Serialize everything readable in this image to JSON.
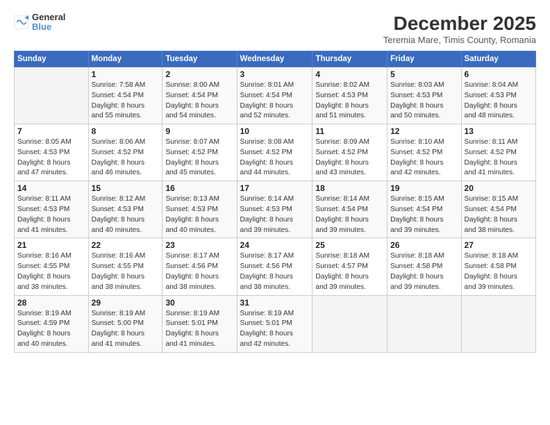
{
  "logo": {
    "line1": "General",
    "line2": "Blue"
  },
  "title": "December 2025",
  "location": "Teremia Mare, Timis County, Romania",
  "days_of_week": [
    "Sunday",
    "Monday",
    "Tuesday",
    "Wednesday",
    "Thursday",
    "Friday",
    "Saturday"
  ],
  "weeks": [
    [
      {
        "day": "",
        "info": ""
      },
      {
        "day": "1",
        "info": "Sunrise: 7:58 AM\nSunset: 4:54 PM\nDaylight: 8 hours\nand 55 minutes."
      },
      {
        "day": "2",
        "info": "Sunrise: 8:00 AM\nSunset: 4:54 PM\nDaylight: 8 hours\nand 54 minutes."
      },
      {
        "day": "3",
        "info": "Sunrise: 8:01 AM\nSunset: 4:54 PM\nDaylight: 8 hours\nand 52 minutes."
      },
      {
        "day": "4",
        "info": "Sunrise: 8:02 AM\nSunset: 4:53 PM\nDaylight: 8 hours\nand 51 minutes."
      },
      {
        "day": "5",
        "info": "Sunrise: 8:03 AM\nSunset: 4:53 PM\nDaylight: 8 hours\nand 50 minutes."
      },
      {
        "day": "6",
        "info": "Sunrise: 8:04 AM\nSunset: 4:53 PM\nDaylight: 8 hours\nand 48 minutes."
      }
    ],
    [
      {
        "day": "7",
        "info": "Sunrise: 8:05 AM\nSunset: 4:53 PM\nDaylight: 8 hours\nand 47 minutes."
      },
      {
        "day": "8",
        "info": "Sunrise: 8:06 AM\nSunset: 4:52 PM\nDaylight: 8 hours\nand 46 minutes."
      },
      {
        "day": "9",
        "info": "Sunrise: 8:07 AM\nSunset: 4:52 PM\nDaylight: 8 hours\nand 45 minutes."
      },
      {
        "day": "10",
        "info": "Sunrise: 8:08 AM\nSunset: 4:52 PM\nDaylight: 8 hours\nand 44 minutes."
      },
      {
        "day": "11",
        "info": "Sunrise: 8:09 AM\nSunset: 4:52 PM\nDaylight: 8 hours\nand 43 minutes."
      },
      {
        "day": "12",
        "info": "Sunrise: 8:10 AM\nSunset: 4:52 PM\nDaylight: 8 hours\nand 42 minutes."
      },
      {
        "day": "13",
        "info": "Sunrise: 8:11 AM\nSunset: 4:52 PM\nDaylight: 8 hours\nand 41 minutes."
      }
    ],
    [
      {
        "day": "14",
        "info": "Sunrise: 8:11 AM\nSunset: 4:53 PM\nDaylight: 8 hours\nand 41 minutes."
      },
      {
        "day": "15",
        "info": "Sunrise: 8:12 AM\nSunset: 4:53 PM\nDaylight: 8 hours\nand 40 minutes."
      },
      {
        "day": "16",
        "info": "Sunrise: 8:13 AM\nSunset: 4:53 PM\nDaylight: 8 hours\nand 40 minutes."
      },
      {
        "day": "17",
        "info": "Sunrise: 8:14 AM\nSunset: 4:53 PM\nDaylight: 8 hours\nand 39 minutes."
      },
      {
        "day": "18",
        "info": "Sunrise: 8:14 AM\nSunset: 4:54 PM\nDaylight: 8 hours\nand 39 minutes."
      },
      {
        "day": "19",
        "info": "Sunrise: 8:15 AM\nSunset: 4:54 PM\nDaylight: 8 hours\nand 39 minutes."
      },
      {
        "day": "20",
        "info": "Sunrise: 8:15 AM\nSunset: 4:54 PM\nDaylight: 8 hours\nand 38 minutes."
      }
    ],
    [
      {
        "day": "21",
        "info": "Sunrise: 8:16 AM\nSunset: 4:55 PM\nDaylight: 8 hours\nand 38 minutes."
      },
      {
        "day": "22",
        "info": "Sunrise: 8:16 AM\nSunset: 4:55 PM\nDaylight: 8 hours\nand 38 minutes."
      },
      {
        "day": "23",
        "info": "Sunrise: 8:17 AM\nSunset: 4:56 PM\nDaylight: 8 hours\nand 38 minutes."
      },
      {
        "day": "24",
        "info": "Sunrise: 8:17 AM\nSunset: 4:56 PM\nDaylight: 8 hours\nand 38 minutes."
      },
      {
        "day": "25",
        "info": "Sunrise: 8:18 AM\nSunset: 4:57 PM\nDaylight: 8 hours\nand 39 minutes."
      },
      {
        "day": "26",
        "info": "Sunrise: 8:18 AM\nSunset: 4:58 PM\nDaylight: 8 hours\nand 39 minutes."
      },
      {
        "day": "27",
        "info": "Sunrise: 8:18 AM\nSunset: 4:58 PM\nDaylight: 8 hours\nand 39 minutes."
      }
    ],
    [
      {
        "day": "28",
        "info": "Sunrise: 8:19 AM\nSunset: 4:59 PM\nDaylight: 8 hours\nand 40 minutes."
      },
      {
        "day": "29",
        "info": "Sunrise: 8:19 AM\nSunset: 5:00 PM\nDaylight: 8 hours\nand 41 minutes."
      },
      {
        "day": "30",
        "info": "Sunrise: 8:19 AM\nSunset: 5:01 PM\nDaylight: 8 hours\nand 41 minutes."
      },
      {
        "day": "31",
        "info": "Sunrise: 8:19 AM\nSunset: 5:01 PM\nDaylight: 8 hours\nand 42 minutes."
      },
      {
        "day": "",
        "info": ""
      },
      {
        "day": "",
        "info": ""
      },
      {
        "day": "",
        "info": ""
      }
    ]
  ]
}
